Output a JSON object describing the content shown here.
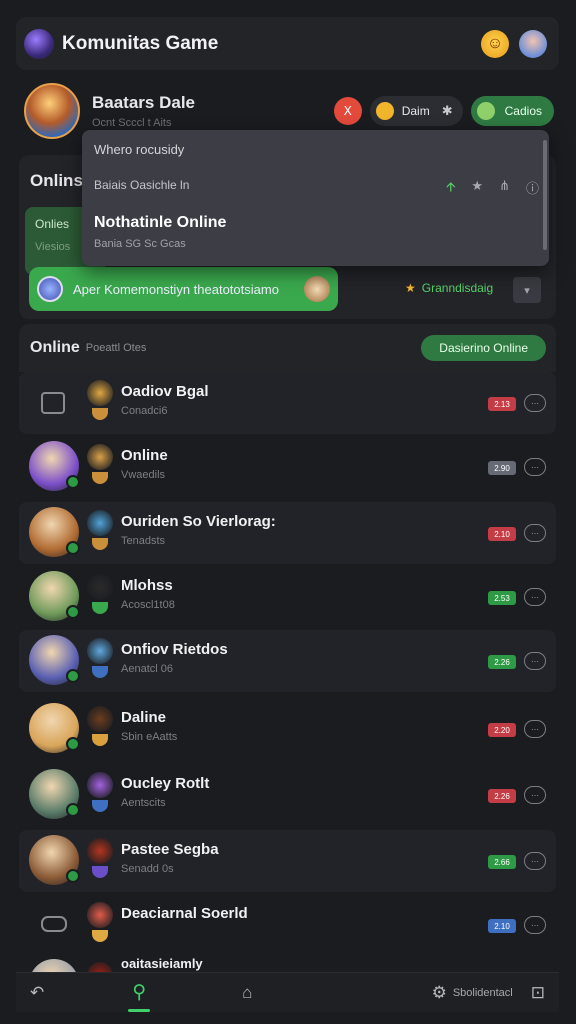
{
  "header": {
    "title": "Komunitas Game",
    "app_icon": "game-logo-icon",
    "emoji_icon": "smiley-face-icon",
    "emoji_glyph": "☺",
    "user_icon": "user-avatar"
  },
  "profile": {
    "name": "Baatars Dale",
    "subtitle": "Ocnt Scccl t Aits",
    "red_badge": "Ⅹ",
    "coin_label": "Daim",
    "coin_gear": "✱",
    "green_label": "Cadios"
  },
  "section1": {
    "label": "Onlins",
    "green_card": {
      "line1": "Onlies",
      "line2": "Viesios"
    },
    "banner_text": "Aper Komemonstiyn theatototsiamo",
    "star_link": "Granndisdaig",
    "star_glyph": "★",
    "chevron": "▾"
  },
  "dropdown": {
    "row1": "Whero  rocusidy",
    "row2": "Baiais Oasichle ln",
    "row2_icons": [
      "🡩",
      "★",
      "⋔",
      "ⓘ"
    ],
    "row3": "Nothatinle Online",
    "row4": "Bania SG Sc Gcas"
  },
  "list_header": {
    "title": "Online",
    "subtitle": "Poeattl Otes",
    "button": "Dasierino Online"
  },
  "rows": [
    {
      "name": "Oadiov Bgal",
      "sub": "Conadci6",
      "tag": "2.13",
      "tag_color": "#c43d46",
      "more": "⋯",
      "avatar": "app-icon",
      "card": true
    },
    {
      "name": "Online",
      "sub": "Vwaedils",
      "tag": "2.90",
      "tag_color": "#666a75",
      "more": "⋯",
      "avatar": "#7b4fc9",
      "card": false
    },
    {
      "name": "Ouriden So Vierlorag:",
      "sub": "Tenadsts",
      "tag": "2.10",
      "tag_color": "#c43d46",
      "more": "⋯",
      "avatar": "#b06a32",
      "card": true
    },
    {
      "name": "Mlohss",
      "sub": "Acoscl1t08",
      "tag": "2.53",
      "tag_color": "#2f9a45",
      "more": "⋯",
      "avatar": "#6f9a5a",
      "card": false
    },
    {
      "name": "Onfiov Rietdos",
      "sub": "Aenatcl 06",
      "tag": "2.26",
      "tag_color": "#2f9a45",
      "more": "⋯",
      "avatar": "#5a5fb2",
      "card": true
    },
    {
      "name": "Daline",
      "sub": "Sbin eAatts",
      "tag": "2.20",
      "tag_color": "#c43d46",
      "more": "⋯",
      "avatar": "#d9a55a",
      "card": false
    },
    {
      "name": "Oucley Rotlt",
      "sub": "Aentscits",
      "tag": "2.26",
      "tag_color": "#c43d46",
      "more": "⋯",
      "avatar": "#5b7d6a",
      "card": false
    },
    {
      "name": "Pastee Segba",
      "sub": "Senadd 0s",
      "tag": "2.66",
      "tag_color": "#2f9a45",
      "more": "⋯",
      "avatar": "#8a5a36",
      "card": true
    },
    {
      "name": "Deaciarnal Soerld",
      "sub": "",
      "tag": "2.10",
      "tag_color": "#3f6fc1",
      "more": "⋯",
      "avatar": "controller-icon",
      "card": false
    },
    {
      "name": "oaitasieiamly",
      "sub": "",
      "tag": "",
      "tag_color": "",
      "more": "",
      "avatar": "#9aa0aa",
      "card": false
    }
  ],
  "bottom_nav": {
    "items": [
      "↶",
      "⚲",
      "⌂",
      "⚙"
    ],
    "text": "Sbolidentacl",
    "last": "⊡"
  }
}
